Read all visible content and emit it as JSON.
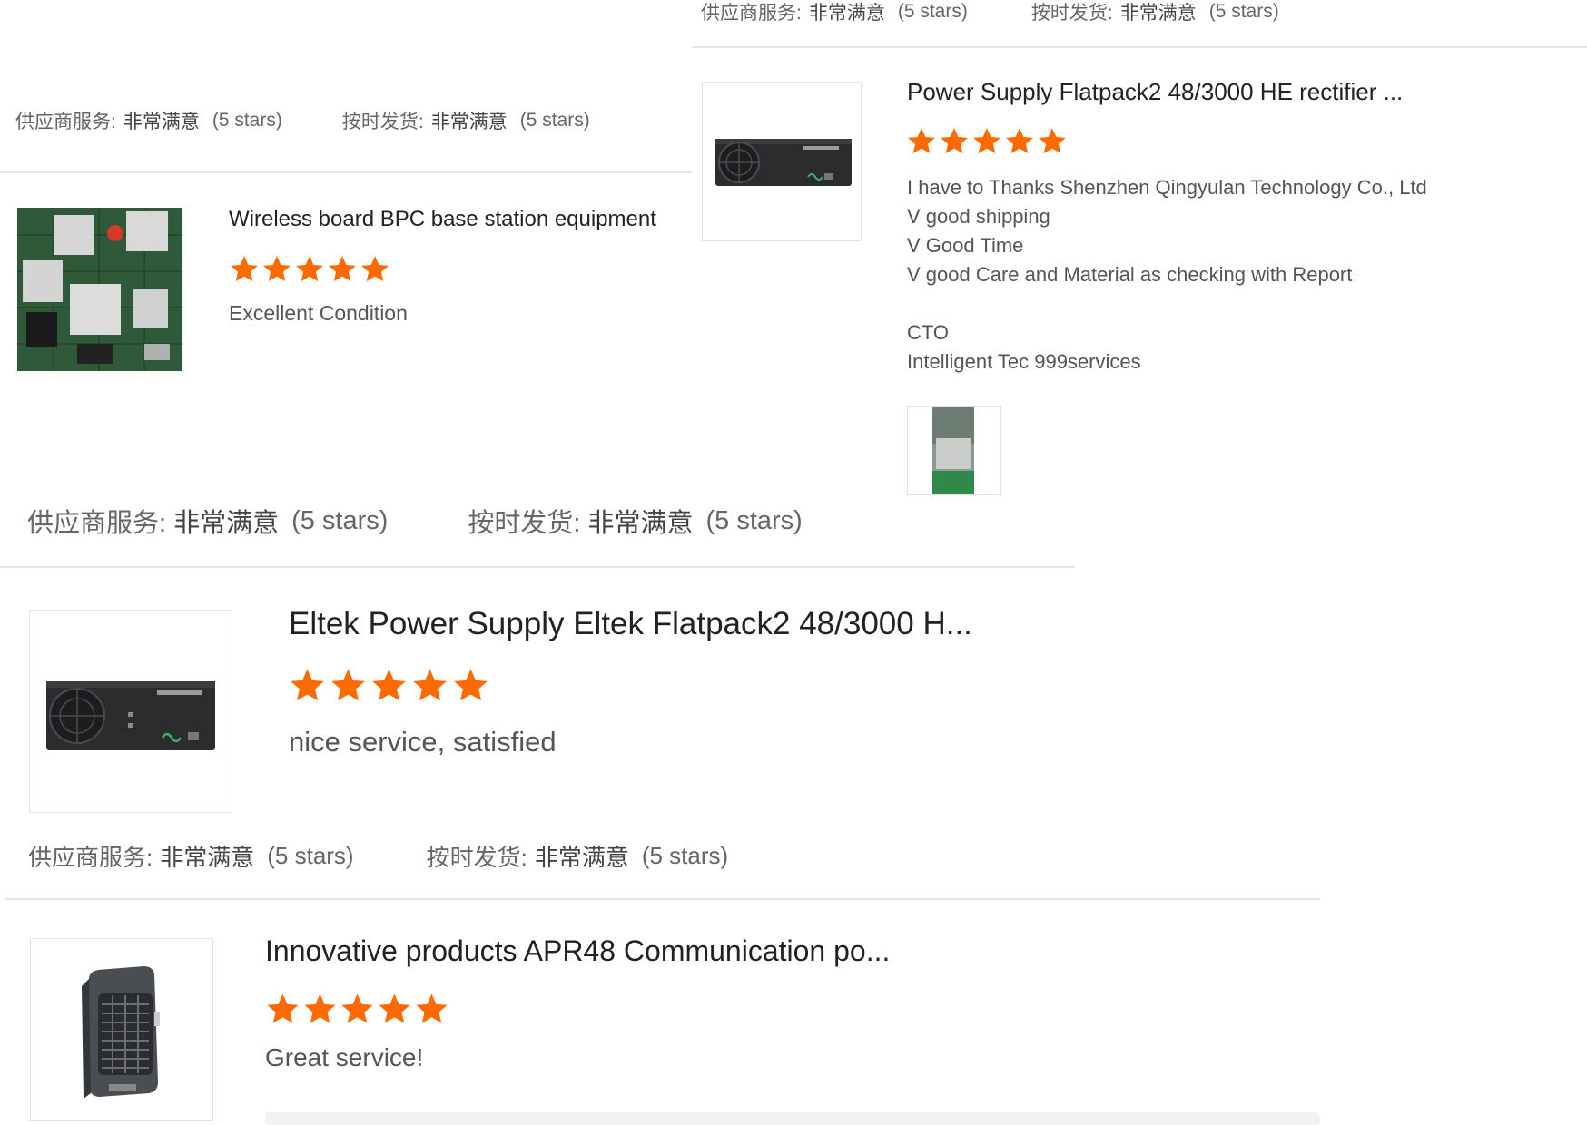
{
  "rating_labels": {
    "service_label": "供应商服务:",
    "shipping_label": "按时发货:",
    "value": "非常满意",
    "stars_text": "(5 stars)"
  },
  "reviews": [
    {
      "title": "Wireless board BPC base station equipment",
      "rating": 5,
      "text_lines": [
        "Excellent Condition"
      ]
    },
    {
      "title": "Power Supply Flatpack2 48/3000 HE rectifier ...",
      "rating": 5,
      "text_lines": [
        "I have to Thanks Shenzhen Qingyulan Technology Co., Ltd",
        "V good shipping",
        "V Good Time",
        "V good Care and Material as checking with Report",
        "",
        "CTO",
        "Intelligent Tec 999services"
      ]
    },
    {
      "title": "Eltek Power Supply Eltek Flatpack2 48/3000 H...",
      "rating": 5,
      "text_lines": [
        "nice service, satisfied"
      ]
    },
    {
      "title": "Innovative products APR48 Communication po...",
      "rating": 5,
      "text_lines": [
        "Great service!"
      ]
    }
  ],
  "colors": {
    "star": "#ff6a00",
    "divider": "#e5e5e5"
  },
  "icons": {
    "star": "star-icon",
    "board_image": "circuit-board-image",
    "rectifier_image": "rectifier-module-image",
    "apr48_image": "apr48-rectifier-image",
    "photo_thumb": "customer-photo-thumbnail"
  }
}
